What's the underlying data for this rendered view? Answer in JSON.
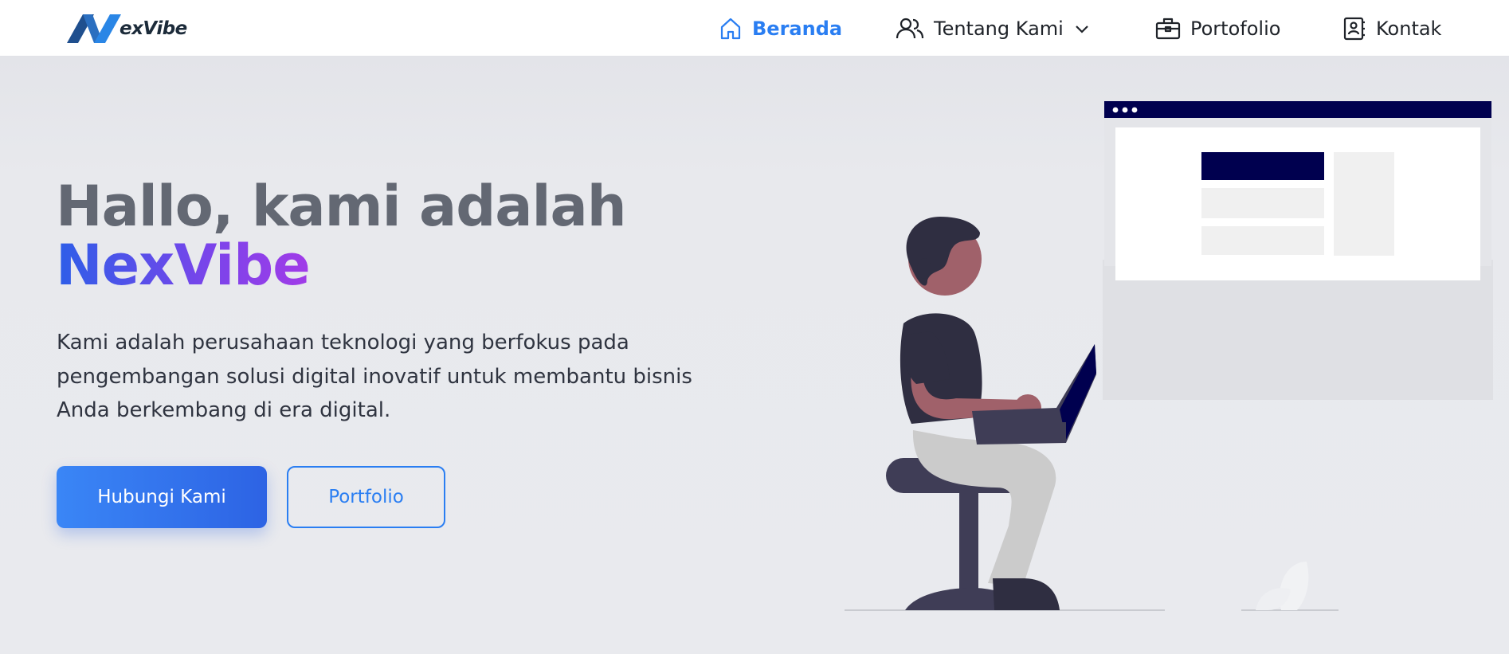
{
  "brand": {
    "logo_text": "exVibe"
  },
  "nav": {
    "items": [
      {
        "label": "Beranda",
        "icon": "home-icon",
        "active": true
      },
      {
        "label": "Tentang Kami",
        "icon": "users-icon",
        "dropdown": true
      },
      {
        "label": "Portofolio",
        "icon": "briefcase-icon"
      },
      {
        "label": "Kontak",
        "icon": "contact-book-icon"
      }
    ]
  },
  "hero": {
    "title_line1": "Hallo, kami adalah",
    "title_brand": "NexVibe",
    "description": "Kami adalah perusahaan teknologi yang berfokus pada pengembangan solusi digital inovatif untuk membantu bisnis Anda berkembang di era digital.",
    "primary_button": "Hubungi Kami",
    "secondary_button": "Portfolio"
  },
  "colors": {
    "accent": "#2a7ef2",
    "button_gradient_start": "#3a86f6",
    "button_gradient_end": "#2d63e4",
    "brand_gradient_start": "#2d5ee8",
    "brand_gradient_end": "#a13be8",
    "headline": "#636873",
    "background": "#e8e9ed",
    "illustration_navy": "#00004f"
  }
}
